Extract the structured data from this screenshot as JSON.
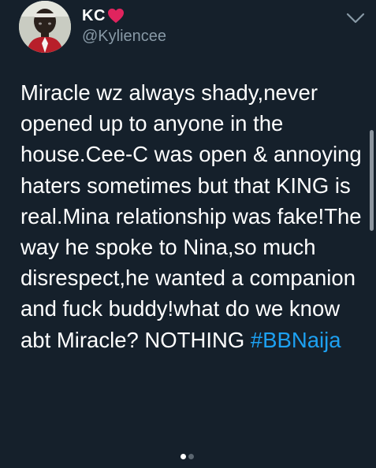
{
  "author": {
    "display_name": "KC",
    "handle": "@Kyliencee",
    "name_emoji": "red-heart-icon"
  },
  "tweet": {
    "text": "Miracle wz always shady,never opened up to anyone in the house.Cee-C was open & annoying haters sometimes but that KING is real.Mina relationship was fake!The way he spoke to Nina,so much disrespect,he wanted a companion and fuck buddy!what do we know abt Miracle? NOTHING ",
    "hashtag": "#BBNaija"
  },
  "media_pager": {
    "total": 2,
    "current": 1
  },
  "colors": {
    "background": "#15202b",
    "text": "#ffffff",
    "secondary_text": "#8899a6",
    "link": "#1da1f2",
    "heart": "#e0245e"
  },
  "icons": {
    "menu": "chevron-down-icon",
    "avatar": "profile-photo"
  }
}
